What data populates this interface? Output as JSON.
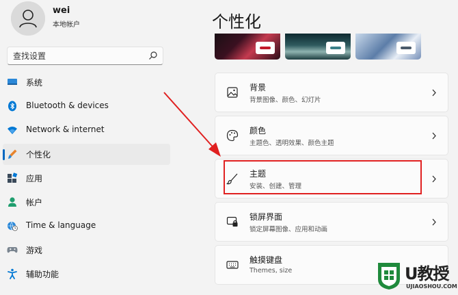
{
  "user": {
    "name": "wei",
    "account_type": "本地帐户"
  },
  "search": {
    "placeholder": "查找设置"
  },
  "nav": {
    "items": [
      {
        "label": "系统",
        "icon": "monitor-icon"
      },
      {
        "label": "Bluetooth & devices",
        "icon": "bluetooth-icon"
      },
      {
        "label": "Network & internet",
        "icon": "wifi-icon"
      },
      {
        "label": "个性化",
        "icon": "brush-icon",
        "selected": true
      },
      {
        "label": "应用",
        "icon": "apps-icon"
      },
      {
        "label": "帐户",
        "icon": "person-icon"
      },
      {
        "label": "Time & language",
        "icon": "globe-clock-icon"
      },
      {
        "label": "游戏",
        "icon": "gamepad-icon"
      },
      {
        "label": "辅助功能",
        "icon": "accessibility-icon"
      }
    ]
  },
  "main": {
    "title": "个性化",
    "cards": [
      {
        "title": "背景",
        "desc": "背景图像、颜色、幻灯片",
        "icon": "image-icon"
      },
      {
        "title": "颜色",
        "desc": "主题色、透明效果、颜色主题",
        "icon": "palette-icon"
      },
      {
        "title": "主题",
        "desc": "安装、创建、管理",
        "icon": "brush-icon"
      },
      {
        "title": "锁屏界面",
        "desc": "锁定屏幕图像、应用和动画",
        "icon": "lock-screen-icon"
      },
      {
        "title": "触摸键盘",
        "desc": "Themes, size",
        "icon": "keyboard-icon"
      }
    ]
  },
  "colors": {
    "accent": "#0067c0",
    "highlight": "#e02020"
  },
  "watermark": {
    "title": "U教授",
    "subtitle": "UJIAOSHOU.COM"
  }
}
